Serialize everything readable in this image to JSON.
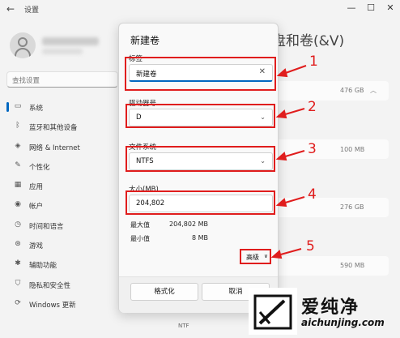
{
  "window": {
    "back_glyph": "←",
    "title": "设置",
    "minimize": "—",
    "maximize": "☐",
    "close": "✕"
  },
  "sidebar": {
    "search_placeholder": "查找设置",
    "items": [
      {
        "label": "系统",
        "icon": "monitor-icon",
        "glyph": "▭",
        "active": true
      },
      {
        "label": "蓝牙和其他设备",
        "icon": "bluetooth-icon",
        "glyph": "ᛒ",
        "active": false
      },
      {
        "label": "网络 & Internet",
        "icon": "wifi-icon",
        "glyph": "◈",
        "active": false
      },
      {
        "label": "个性化",
        "icon": "brush-icon",
        "glyph": "✎",
        "active": false
      },
      {
        "label": "应用",
        "icon": "apps-icon",
        "glyph": "▦",
        "active": false
      },
      {
        "label": "帐户",
        "icon": "person-icon",
        "glyph": "◉",
        "active": false
      },
      {
        "label": "时间和语言",
        "icon": "clock-icon",
        "glyph": "◷",
        "active": false
      },
      {
        "label": "游戏",
        "icon": "gamepad-icon",
        "glyph": "⊛",
        "active": false
      },
      {
        "label": "辅助功能",
        "icon": "accessibility-icon",
        "glyph": "✱",
        "active": false
      },
      {
        "label": "隐私和安全性",
        "icon": "shield-icon",
        "glyph": "⛉",
        "active": false
      },
      {
        "label": "Windows 更新",
        "icon": "update-icon",
        "glyph": "⟳",
        "active": false
      }
    ]
  },
  "main": {
    "heading": "盘和卷(&V)",
    "rows": [
      {
        "size": "476 GB",
        "chevron": "︿"
      },
      {
        "size": "",
        "chevron": ""
      },
      {
        "size": "100 MB",
        "chevron": ""
      },
      {
        "size": "",
        "chevron": ""
      },
      {
        "size": "276 GB",
        "chevron": ""
      },
      {
        "size": "",
        "chevron": ""
      },
      {
        "size": "590 MB",
        "chevron": ""
      }
    ],
    "bottom_tag": "NTF"
  },
  "dialog": {
    "title": "新建卷",
    "label_field": {
      "label": "标签",
      "value": "新建卷",
      "clear_glyph": "✕"
    },
    "drive_field": {
      "label": "驱动器号",
      "value": "D"
    },
    "fs_field": {
      "label": "文件系统",
      "value": "NTFS"
    },
    "size_field": {
      "label": "大小(MB)",
      "value": "204,802"
    },
    "max": {
      "label": "最大值",
      "value": "204,802 MB"
    },
    "min": {
      "label": "最小值",
      "value": "8 MB"
    },
    "advanced_label": "高级",
    "format_button": "格式化",
    "cancel_button": "取消"
  },
  "annotations": [
    "1",
    "2",
    "3",
    "4",
    "5"
  ],
  "watermark": {
    "text": "爱纯净",
    "url": "aichunjing.com"
  },
  "colors": {
    "accent": "#0067c0",
    "annotation": "#e01d1d"
  }
}
